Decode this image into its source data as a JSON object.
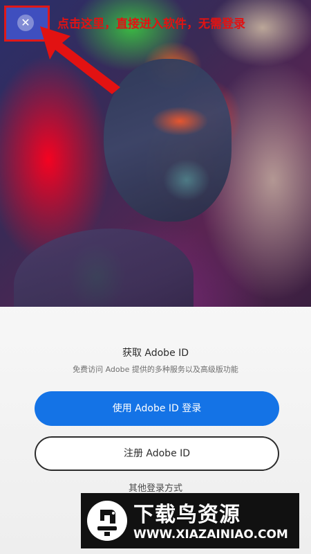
{
  "hero": {
    "close_icon": "close-icon",
    "close_glyph": "✕",
    "annotation": "点击这里，直接进入软件，无需登录"
  },
  "signin": {
    "title": "获取 Adobe ID",
    "subtitle": "免费访问 Adobe 提供的多种服务以及高级版功能",
    "primary_button": "使用 Adobe ID 登录",
    "secondary_button": "注册 Adobe ID",
    "other_link": "其他登录方式"
  },
  "watermark": {
    "name": "下载鸟资源",
    "url": "WWW.XIAZAINIAO.COM"
  },
  "colors": {
    "accent": "#1473e6",
    "annotation": "#e21212"
  }
}
